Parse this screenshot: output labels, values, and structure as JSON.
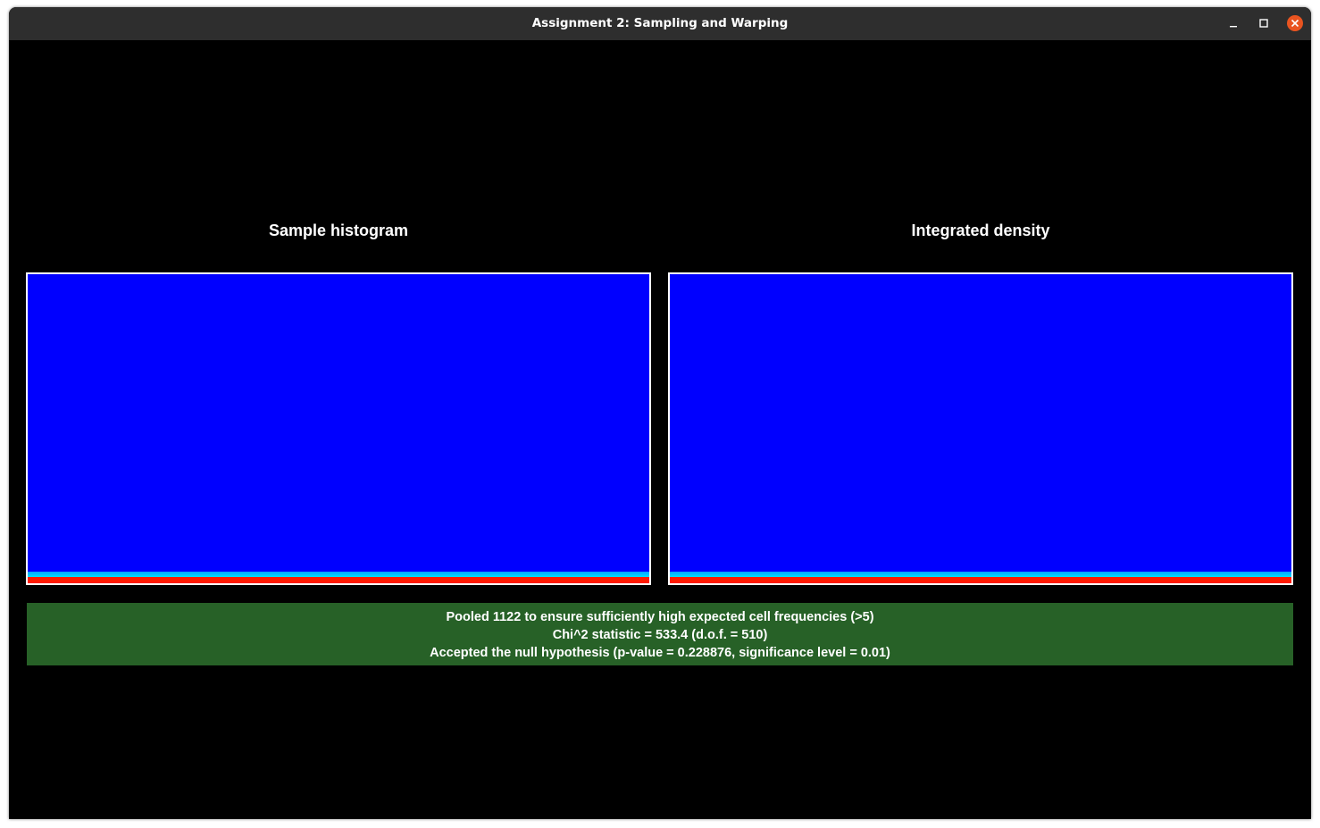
{
  "window": {
    "title": "Assignment 2: Sampling and Warping",
    "controls": {
      "minimize_icon": "minimize-icon",
      "maximize_icon": "maximize-icon",
      "close_icon": "close-icon",
      "close_color": "#e95420"
    }
  },
  "panels": {
    "left": {
      "title": "Sample histogram"
    },
    "right": {
      "title": "Integrated density"
    }
  },
  "colors": {
    "plot_background": "#0000ff",
    "plot_band_cyan": "#00c8ff",
    "plot_band_red": "#ff1a00",
    "status_background": "#276127",
    "titlebar": "#2e2e2e"
  },
  "status": {
    "lines": [
      "Pooled 1122 to ensure sufficiently high expected cell frequencies (>5)",
      "Chi^2 statistic = 533.4 (d.o.f. = 510)",
      "Accepted the null hypothesis (p-value = 0.228876, significance level = 0.01)"
    ]
  }
}
